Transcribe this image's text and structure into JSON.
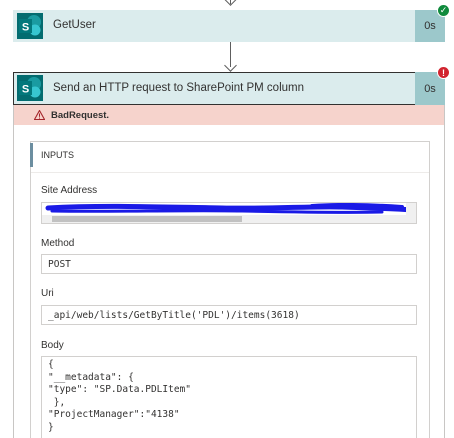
{
  "steps": [
    {
      "title": "GetUser",
      "duration": "0s",
      "status": "success"
    },
    {
      "title": "Send an HTTP request to SharePoint PM column",
      "duration": "0s",
      "status": "failed",
      "error": "BadRequest.",
      "inputs": {
        "header": "INPUTS",
        "site_address_label": "Site Address",
        "site_address_value": "",
        "method_label": "Method",
        "method_value": "POST",
        "uri_label": "Uri",
        "uri_value": "_api/web/lists/GetByTitle('PDL')/items(3618)",
        "body_label": "Body",
        "body_value": "{\n\"__metadata\": {\n\"type\": \"SP.Data.PDLItem\"\n },\n\"ProjectManager\":\"4138\"\n}"
      }
    }
  ],
  "icons": {
    "sharepoint": "sharepoint-icon",
    "success": "check-icon",
    "error": "exclamation-icon"
  },
  "colors": {
    "header_bg": "#dbeced",
    "duration_bg": "#9cc8cb",
    "error_bg": "#f6d3cc",
    "success": "#0f8a3c",
    "error": "#d1242f",
    "sharepoint": "#036c70",
    "redaction": "#1a1ae6"
  }
}
